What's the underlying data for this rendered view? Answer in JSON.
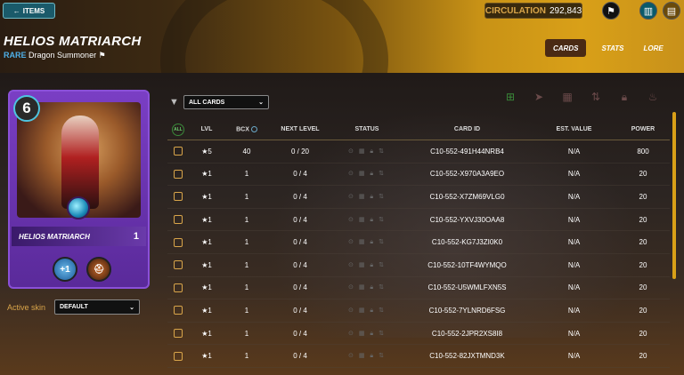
{
  "header": {
    "items_button": "ITEMS",
    "circulation_label": "CIRCULATION",
    "circulation_value": "292,843",
    "title": "HELIOS MATRIARCH",
    "rarity": "RARE",
    "card_type": "Dragon Summoner"
  },
  "tabs": [
    {
      "label": "CARDS",
      "active": true
    },
    {
      "label": "STATS",
      "active": false
    },
    {
      "label": "LORE",
      "active": false
    }
  ],
  "card": {
    "mana": "6",
    "name": "HELIOS MATRIARCH",
    "level": "1",
    "ability_text": "+1"
  },
  "skin": {
    "label": "Active skin",
    "selected": "DEFAULT"
  },
  "filter": {
    "selected": "ALL CARDS"
  },
  "table": {
    "all_label": "ALL",
    "columns": [
      "LVL",
      "BCX",
      "NEXT LEVEL",
      "STATUS",
      "CARD ID",
      "EST. VALUE",
      "POWER"
    ],
    "rows": [
      {
        "lvl": "★5",
        "bcx": "40",
        "next": "0 / 20",
        "id": "C10-552-491H44NRB4",
        "est": "N/A",
        "power": "800"
      },
      {
        "lvl": "★1",
        "bcx": "1",
        "next": "0 / 4",
        "id": "C10-552-X970A3A9EO",
        "est": "N/A",
        "power": "20"
      },
      {
        "lvl": "★1",
        "bcx": "1",
        "next": "0 / 4",
        "id": "C10-552-X7ZM69VLG0",
        "est": "N/A",
        "power": "20"
      },
      {
        "lvl": "★1",
        "bcx": "1",
        "next": "0 / 4",
        "id": "C10-552-YXVJ30OAA8",
        "est": "N/A",
        "power": "20"
      },
      {
        "lvl": "★1",
        "bcx": "1",
        "next": "0 / 4",
        "id": "C10-552-KG7J3ZI0K0",
        "est": "N/A",
        "power": "20"
      },
      {
        "lvl": "★1",
        "bcx": "1",
        "next": "0 / 4",
        "id": "C10-552-10TF4WYMQO",
        "est": "N/A",
        "power": "20"
      },
      {
        "lvl": "★1",
        "bcx": "1",
        "next": "0 / 4",
        "id": "C10-552-U5WMLFXN5S",
        "est": "N/A",
        "power": "20"
      },
      {
        "lvl": "★1",
        "bcx": "1",
        "next": "0 / 4",
        "id": "C10-552-7YLNRD6FSG",
        "est": "N/A",
        "power": "20"
      },
      {
        "lvl": "★1",
        "bcx": "1",
        "next": "0 / 4",
        "id": "C10-552-2JPR2XS8I8",
        "est": "N/A",
        "power": "20"
      },
      {
        "lvl": "★1",
        "bcx": "1",
        "next": "0 / 4",
        "id": "C10-552-82JXTMND3K",
        "est": "N/A",
        "power": "20"
      }
    ]
  }
}
